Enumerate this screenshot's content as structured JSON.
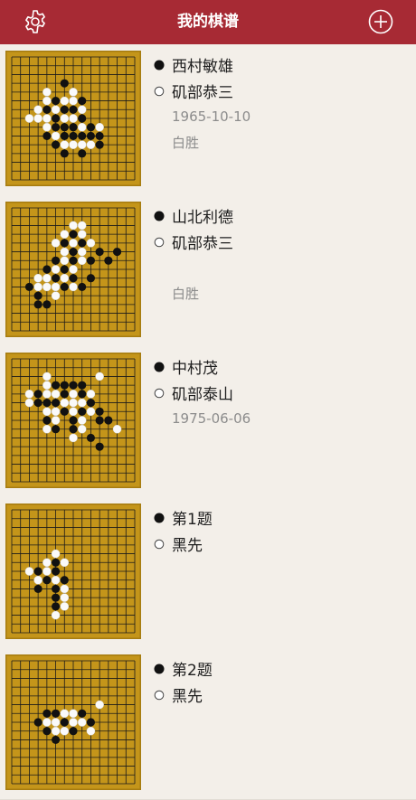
{
  "navbar": {
    "title": "我的棋谱",
    "settings_icon": "gear-icon",
    "add_icon": "plus-circle-icon",
    "background_color": "#a72a34"
  },
  "board": {
    "wood_color": "#c4951a",
    "border_color": "#a67c10",
    "size": 19,
    "visible_lines": 15
  },
  "games": [
    {
      "black": "西村敏雄",
      "white": "矶部恭三",
      "date": "1965-10-10",
      "result": "白胜",
      "black_stones": [
        [
          3,
          6
        ],
        [
          5,
          5
        ],
        [
          5,
          8
        ],
        [
          6,
          4
        ],
        [
          6,
          6
        ],
        [
          6,
          7
        ],
        [
          7,
          5
        ],
        [
          7,
          8
        ],
        [
          8,
          5
        ],
        [
          8,
          6
        ],
        [
          8,
          7
        ],
        [
          8,
          9
        ],
        [
          9,
          4
        ],
        [
          9,
          6
        ],
        [
          9,
          7
        ],
        [
          9,
          8
        ],
        [
          9,
          9
        ],
        [
          9,
          10
        ],
        [
          10,
          5
        ],
        [
          10,
          10
        ],
        [
          11,
          6
        ],
        [
          11,
          8
        ]
      ],
      "white_stones": [
        [
          4,
          4
        ],
        [
          4,
          7
        ],
        [
          5,
          4
        ],
        [
          5,
          6
        ],
        [
          5,
          7
        ],
        [
          6,
          3
        ],
        [
          6,
          5
        ],
        [
          6,
          8
        ],
        [
          7,
          2
        ],
        [
          7,
          3
        ],
        [
          7,
          4
        ],
        [
          7,
          6
        ],
        [
          7,
          7
        ],
        [
          8,
          4
        ],
        [
          8,
          8
        ],
        [
          8,
          10
        ],
        [
          9,
          5
        ],
        [
          10,
          6
        ],
        [
          10,
          7
        ],
        [
          10,
          8
        ],
        [
          10,
          9
        ]
      ]
    },
    {
      "black": "山北利德",
      "white": "矶部恭三",
      "date": "",
      "result": "白胜",
      "black_stones": [
        [
          3,
          7
        ],
        [
          4,
          6
        ],
        [
          4,
          8
        ],
        [
          5,
          7
        ],
        [
          5,
          10
        ],
        [
          6,
          5
        ],
        [
          6,
          7
        ],
        [
          6,
          9
        ],
        [
          7,
          4
        ],
        [
          7,
          6
        ],
        [
          8,
          5
        ],
        [
          8,
          7
        ],
        [
          8,
          9
        ],
        [
          9,
          2
        ],
        [
          9,
          6
        ],
        [
          9,
          8
        ],
        [
          10,
          3
        ],
        [
          11,
          3
        ],
        [
          11,
          4
        ],
        [
          6,
          11
        ],
        [
          5,
          12
        ]
      ],
      "white_stones": [
        [
          2,
          7
        ],
        [
          2,
          8
        ],
        [
          3,
          6
        ],
        [
          3,
          8
        ],
        [
          4,
          5
        ],
        [
          4,
          7
        ],
        [
          4,
          9
        ],
        [
          5,
          6
        ],
        [
          5,
          8
        ],
        [
          6,
          6
        ],
        [
          6,
          8
        ],
        [
          7,
          5
        ],
        [
          7,
          7
        ],
        [
          8,
          3
        ],
        [
          8,
          4
        ],
        [
          8,
          6
        ],
        [
          9,
          3
        ],
        [
          9,
          4
        ],
        [
          9,
          5
        ],
        [
          10,
          5
        ],
        [
          9,
          7
        ]
      ]
    },
    {
      "black": "中村茂",
      "white": "矶部泰山",
      "date": "1975-06-06",
      "result": "",
      "black_stones": [
        [
          3,
          5
        ],
        [
          3,
          6
        ],
        [
          3,
          7
        ],
        [
          3,
          8
        ],
        [
          4,
          3
        ],
        [
          4,
          6
        ],
        [
          4,
          8
        ],
        [
          5,
          3
        ],
        [
          5,
          4
        ],
        [
          5,
          5
        ],
        [
          5,
          9
        ],
        [
          6,
          6
        ],
        [
          6,
          8
        ],
        [
          6,
          10
        ],
        [
          7,
          4
        ],
        [
          7,
          7
        ],
        [
          7,
          10
        ],
        [
          7,
          11
        ],
        [
          8,
          5
        ],
        [
          8,
          7
        ],
        [
          9,
          9
        ],
        [
          10,
          10
        ]
      ],
      "white_stones": [
        [
          2,
          4
        ],
        [
          2,
          10
        ],
        [
          3,
          4
        ],
        [
          4,
          2
        ],
        [
          4,
          4
        ],
        [
          4,
          5
        ],
        [
          4,
          7
        ],
        [
          4,
          9
        ],
        [
          5,
          2
        ],
        [
          5,
          6
        ],
        [
          5,
          7
        ],
        [
          5,
          8
        ],
        [
          6,
          4
        ],
        [
          6,
          5
        ],
        [
          6,
          7
        ],
        [
          6,
          9
        ],
        [
          7,
          5
        ],
        [
          7,
          8
        ],
        [
          8,
          4
        ],
        [
          8,
          8
        ],
        [
          9,
          7
        ],
        [
          8,
          12
        ]
      ]
    },
    {
      "black": "第1题",
      "white": "黑先",
      "date": "",
      "result": "",
      "black_stones": [
        [
          6,
          5
        ],
        [
          7,
          3
        ],
        [
          7,
          5
        ],
        [
          8,
          4
        ],
        [
          8,
          6
        ],
        [
          9,
          3
        ],
        [
          9,
          5
        ],
        [
          10,
          5
        ],
        [
          11,
          5
        ]
      ],
      "white_stones": [
        [
          5,
          5
        ],
        [
          6,
          4
        ],
        [
          6,
          6
        ],
        [
          7,
          2
        ],
        [
          7,
          4
        ],
        [
          8,
          3
        ],
        [
          8,
          5
        ],
        [
          9,
          6
        ],
        [
          10,
          6
        ],
        [
          11,
          6
        ],
        [
          12,
          5
        ]
      ]
    },
    {
      "black": "第2题",
      "white": "黑先",
      "date": "",
      "result": "",
      "black_stones": [
        [
          6,
          4
        ],
        [
          6,
          5
        ],
        [
          7,
          3
        ],
        [
          7,
          6
        ],
        [
          8,
          4
        ],
        [
          8,
          7
        ],
        [
          9,
          5
        ],
        [
          7,
          9
        ],
        [
          6,
          8
        ]
      ],
      "white_stones": [
        [
          6,
          6
        ],
        [
          6,
          7
        ],
        [
          7,
          4
        ],
        [
          7,
          5
        ],
        [
          7,
          7
        ],
        [
          7,
          8
        ],
        [
          8,
          5
        ],
        [
          8,
          6
        ],
        [
          5,
          10
        ],
        [
          8,
          9
        ]
      ]
    }
  ]
}
